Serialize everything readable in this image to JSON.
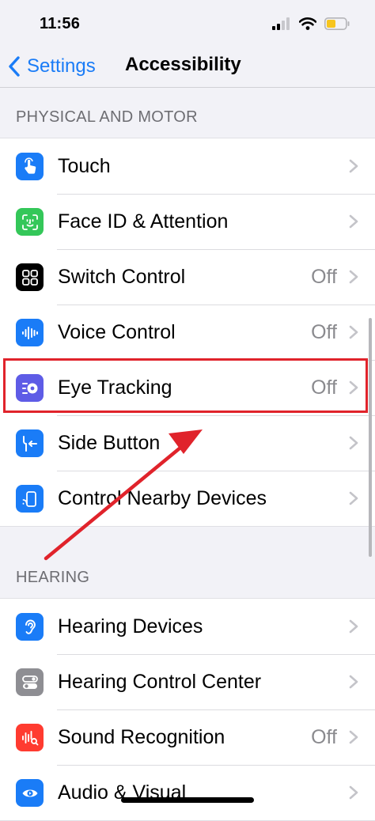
{
  "status_bar": {
    "time": "11:56",
    "battery_color": "#f7c51e"
  },
  "nav": {
    "back_label": "Settings",
    "title": "Accessibility"
  },
  "sections": [
    {
      "header": "PHYSICAL AND MOTOR",
      "items": [
        {
          "label": "Touch",
          "value": "",
          "icon": "hand-tap-icon",
          "color": "#1a7cf7"
        },
        {
          "label": "Face ID & Attention",
          "value": "",
          "icon": "face-id-icon",
          "color": "#34c759"
        },
        {
          "label": "Switch Control",
          "value": "Off",
          "icon": "switch-control-icon",
          "color": "#000000"
        },
        {
          "label": "Voice Control",
          "value": "Off",
          "icon": "voice-control-icon",
          "color": "#1a7cf7"
        },
        {
          "label": "Eye Tracking",
          "value": "Off",
          "icon": "eye-tracking-icon",
          "color": "#5e5ce6"
        },
        {
          "label": "Side Button",
          "value": "",
          "icon": "side-button-icon",
          "color": "#1a7cf7"
        },
        {
          "label": "Control Nearby Devices",
          "value": "",
          "icon": "nearby-devices-icon",
          "color": "#1a7cf7"
        }
      ]
    },
    {
      "header": "HEARING",
      "items": [
        {
          "label": "Hearing Devices",
          "value": "",
          "icon": "ear-icon",
          "color": "#1a7cf7"
        },
        {
          "label": "Hearing Control Center",
          "value": "",
          "icon": "toggles-icon",
          "color": "#8e8e93"
        },
        {
          "label": "Sound Recognition",
          "value": "Off",
          "icon": "sound-recognition-icon",
          "color": "#ff3b30"
        },
        {
          "label": "Audio & Visual",
          "value": "",
          "icon": "audio-visual-icon",
          "color": "#1a7cf7"
        }
      ]
    }
  ],
  "annotation": {
    "highlight_color": "#e0232b"
  }
}
